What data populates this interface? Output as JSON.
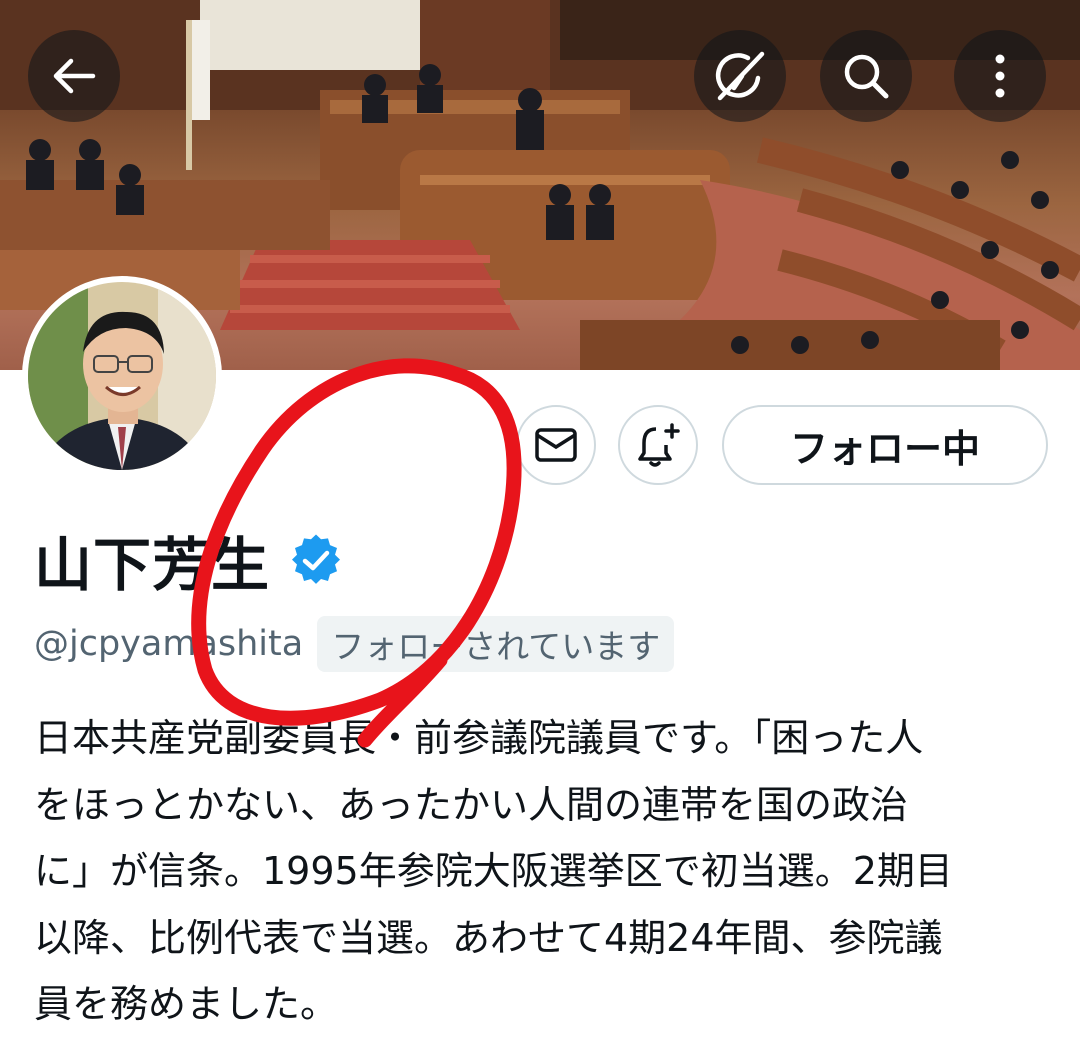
{
  "profile": {
    "display_name": "山下芳生",
    "handle": "@jcpyamashita",
    "follows_you_label": "フォローされています",
    "follow_button_label": "フォロー中",
    "bio_lines": [
      "日本共産党副委員長・前参議院議員です。「困った人",
      "をほっとかない、あったかい人間の連帯を国の政治",
      "に」が信条。1995年参院大阪選挙区で初当選。2期目",
      "以降、比例代表で当選。あわせて4期24年間、参院議",
      "員を務めました。"
    ]
  },
  "icons": {
    "back": "arrow-left-icon",
    "grok": "grok-icon",
    "search": "search-icon",
    "more": "more-vertical-icon",
    "message": "envelope-icon",
    "notify": "bell-plus-icon",
    "verified": "verified-badge-icon"
  },
  "colors": {
    "verified_blue": "#1d9bf0",
    "annotation_red": "#e8141b",
    "secondary_text": "#536471",
    "border": "#cfd9de"
  }
}
